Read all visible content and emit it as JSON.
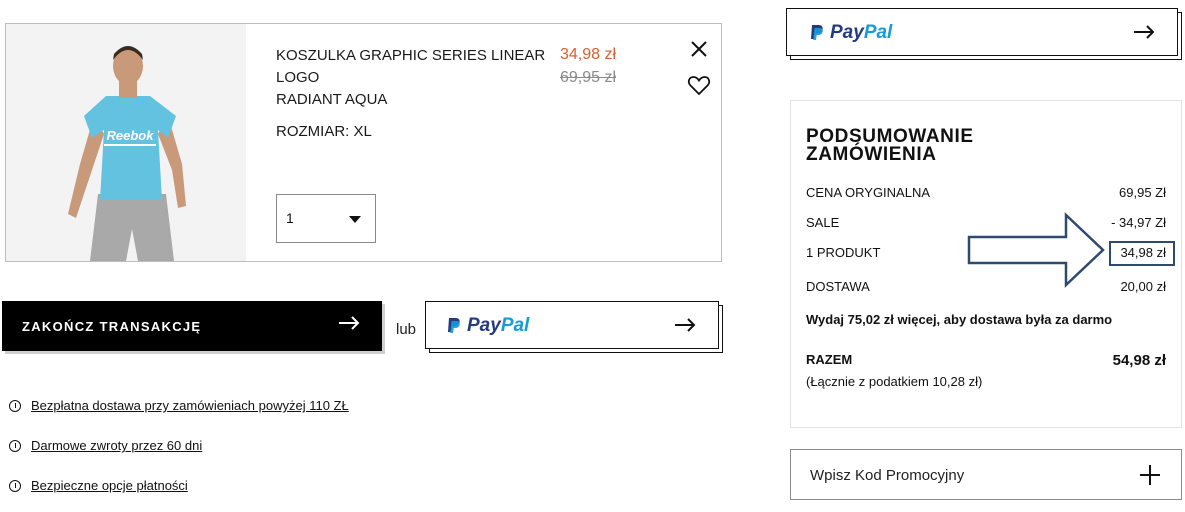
{
  "product": {
    "name_lines": [
      "KOSZULKA GRAPHIC SERIES LINEAR",
      "LOGO",
      "RADIANT AQUA"
    ],
    "size_label": "ROZMIAR: XL",
    "price_now": "34,98 zł",
    "price_old": "69,95 zł",
    "quantity": "1",
    "image_brand_text": "Reebok"
  },
  "actions": {
    "checkout_label": "ZAKOŃCZ TRANSAKCJĘ",
    "or_label": "lub",
    "paypal_pay": "Pay",
    "paypal_pal": "Pal"
  },
  "info_links": [
    "Bezpłatna dostawa przy zamówieniach powyżej 110 ZŁ",
    "Darmowe zwroty przez 60 dni",
    "Bezpieczne opcje płatności"
  ],
  "summary": {
    "title_line1": "PODSUMOWANIE",
    "title_line2": "ZAMÓWIENIA",
    "rows": [
      {
        "label": "CENA ORYGINALNA",
        "value": "69,95 Zł"
      },
      {
        "label": "SALE",
        "value": "- 34,97 Zł"
      },
      {
        "label": "1 PRODUKT",
        "value": "34,98 zł"
      },
      {
        "label": "DOSTAWA",
        "value": "20,00 zł"
      }
    ],
    "free_shipping_note": "Wydaj 75,02 zł więcej, aby dostawa była za darmo",
    "total_label": "RAZEM",
    "total_value": "54,98 zł",
    "tax_note": "(Łącznie z podatkiem  10,28 zł)"
  },
  "promo": {
    "label": "Wpisz Kod Promocyjny"
  },
  "colors": {
    "sale_price": "#d95c30",
    "paypal_dark": "#253b80",
    "paypal_light": "#179bd7",
    "annotation": "#2e4a6e"
  }
}
